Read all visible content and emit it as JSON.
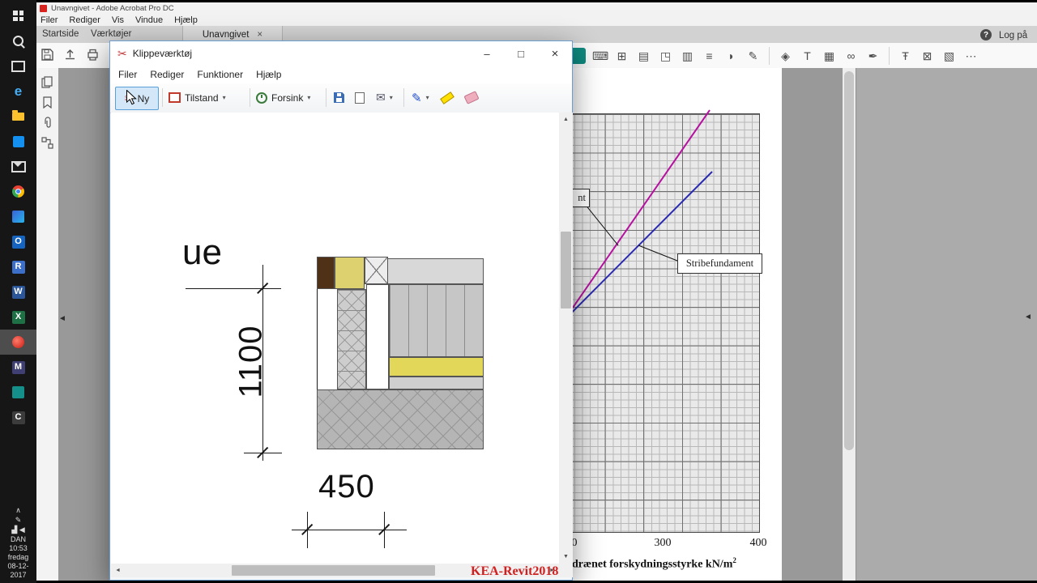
{
  "taskbar": {
    "items": [
      {
        "name": "start",
        "cls": "tb-start"
      },
      {
        "name": "search",
        "cls": "tb-search"
      },
      {
        "name": "task-view",
        "cls": "tb-taskview"
      },
      {
        "name": "edge",
        "glyph": "e",
        "color": "#45aef5",
        "size": "17px",
        "bold": true
      },
      {
        "name": "file-explorer",
        "cls": "tb-folder"
      },
      {
        "name": "store",
        "cls": "tb-store"
      },
      {
        "name": "mail",
        "cls": "tb-mail"
      },
      {
        "name": "chrome",
        "cls": "tb-chrome"
      },
      {
        "name": "photos",
        "cls": "tb-photos"
      },
      {
        "name": "outlook",
        "glyph": "O",
        "bg": "#1565c0"
      },
      {
        "name": "revit",
        "glyph": "R",
        "bg": "#3b6fc9"
      },
      {
        "name": "word",
        "glyph": "W",
        "bg": "#2b579a"
      },
      {
        "name": "excel",
        "glyph": "X",
        "bg": "#1e7145"
      },
      {
        "name": "acrobat",
        "cls": "tb-acrobat",
        "active": true
      },
      {
        "name": "m-app",
        "glyph": "M",
        "bg": "#3f3f73"
      },
      {
        "name": "teal-app",
        "cls": "tb-teal"
      },
      {
        "name": "c-app",
        "glyph": "C",
        "bg": "#3c3c3c"
      }
    ],
    "tray": {
      "chevron": "∧",
      "pen_icon": "✎",
      "network_icon": "▟",
      "volume_icon": "◀",
      "lang": "DAN",
      "time": "10:53",
      "day": "fredag",
      "date": "08-12-2017"
    }
  },
  "acrobat": {
    "title": "Unavngivet - Adobe Acrobat Pro DC",
    "menu": [
      "Filer",
      "Rediger",
      "Vis",
      "Vindue",
      "Hjælp"
    ],
    "tabs": {
      "home": "Startside",
      "tools": "Værktøjer",
      "doc": "Unavngivet",
      "close": "×"
    },
    "help_label": "?",
    "sign_in": "Log på",
    "pane_arrow": "◄",
    "right_icons": [
      {
        "name": "active-tool-icon",
        "cls": "teal",
        "glyph": ""
      },
      {
        "name": "keyboard-icon",
        "glyph": "⌨"
      },
      {
        "name": "grid-icon",
        "glyph": "⊞"
      },
      {
        "name": "export-icon",
        "glyph": "▤"
      },
      {
        "name": "organize-pages-icon",
        "glyph": "◳"
      },
      {
        "name": "reading-mode-icon",
        "glyph": "▥"
      },
      {
        "name": "menu-lines-icon",
        "glyph": "≡"
      },
      {
        "name": "comment-icon",
        "glyph": "◗"
      },
      {
        "name": "pencil-icon",
        "glyph": "✎"
      },
      {
        "name": "separator",
        "sep": true
      },
      {
        "name": "stamp-icon",
        "glyph": "◈"
      },
      {
        "name": "text-tool-icon",
        "glyph": "T"
      },
      {
        "name": "image-icon",
        "glyph": "▦"
      },
      {
        "name": "link-icon",
        "glyph": "∞"
      },
      {
        "name": "signature-icon",
        "glyph": "✒"
      },
      {
        "name": "separator",
        "sep": true
      },
      {
        "name": "edit-text-icon",
        "glyph": "Ŧ"
      },
      {
        "name": "redact-icon",
        "glyph": "⊠"
      },
      {
        "name": "crop-icon",
        "glyph": "▧"
      },
      {
        "name": "more-tools-icon",
        "glyph": "⋯"
      }
    ]
  },
  "snip": {
    "title": "Klippeværktøj",
    "window_buttons": {
      "minimize": "–",
      "maximize": "□",
      "close": "×"
    },
    "menu": [
      "Filer",
      "Rediger",
      "Funktioner",
      "Hjælp"
    ],
    "toolbar": {
      "new": "Ny",
      "mode": "Tilstand",
      "delay": "Forsink",
      "caret": "▾"
    },
    "scroll": {
      "up": "▲",
      "down": "▼",
      "left": "◄",
      "right": "►"
    },
    "capture": {
      "partial_text": "ue",
      "dim_vertical": "1100",
      "dim_horizontal": "450",
      "watermark": "KEA-Revit2018"
    }
  },
  "pdf": {
    "chart_data": {
      "type": "line",
      "xlabel_visible": "drænet forskydningsstyrke kN/m2",
      "x_ticks_visible": [
        "0",
        "300",
        "400"
      ],
      "grid": "fine square graph-paper grid, heavier line every 5 cells",
      "note": "left part of chart and y-axis hidden behind Snipping Tool window; both series are straight rising lines",
      "series": [
        {
          "name": "Stribefundament",
          "color": "#2a2ab0",
          "x_visible_range": [
            205,
            350
          ]
        },
        {
          "name": "nt (label mostly hidden)",
          "color": "#b512a0",
          "x_visible_range": [
            205,
            348
          ]
        }
      ],
      "annotations": [
        "Stribefundament",
        "nt"
      ],
      "legend_position": "inline label boxes with leader lines"
    },
    "labels": {
      "stribefundament": "Stribefundament",
      "partial_label": "nt",
      "tick_0": "0",
      "tick_300": "300",
      "tick_400": "400",
      "axis_label": "drænet forskydningsstyrke kN/m",
      "axis_sup": "2"
    }
  }
}
